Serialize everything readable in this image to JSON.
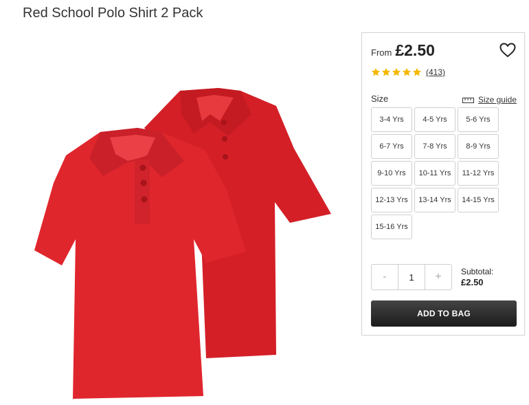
{
  "product": {
    "title": "Red School Polo Shirt 2 Pack"
  },
  "panel": {
    "from_label": "From",
    "price": "£2.50",
    "rating": {
      "stars": 5,
      "count": "(413)"
    },
    "size_label": "Size",
    "size_guide_label": "Size guide",
    "sizes": [
      "3-4 Yrs",
      "4-5 Yrs",
      "5-6 Yrs",
      "6-7 Yrs",
      "7-8 Yrs",
      "8-9 Yrs",
      "9-10 Yrs",
      "10-11 Yrs",
      "11-12 Yrs",
      "12-13 Yrs",
      "13-14 Yrs",
      "14-15 Yrs",
      "15-16 Yrs"
    ],
    "quantity": {
      "minus": "-",
      "value": "1",
      "plus": "+"
    },
    "subtotal": {
      "label": "Subtotal:",
      "amount": "£2.50"
    },
    "add_to_bag": "ADD TO BAG"
  },
  "colors": {
    "shirt": "#e0262d",
    "star": "#f5b800",
    "button": "#2a2a2a"
  }
}
